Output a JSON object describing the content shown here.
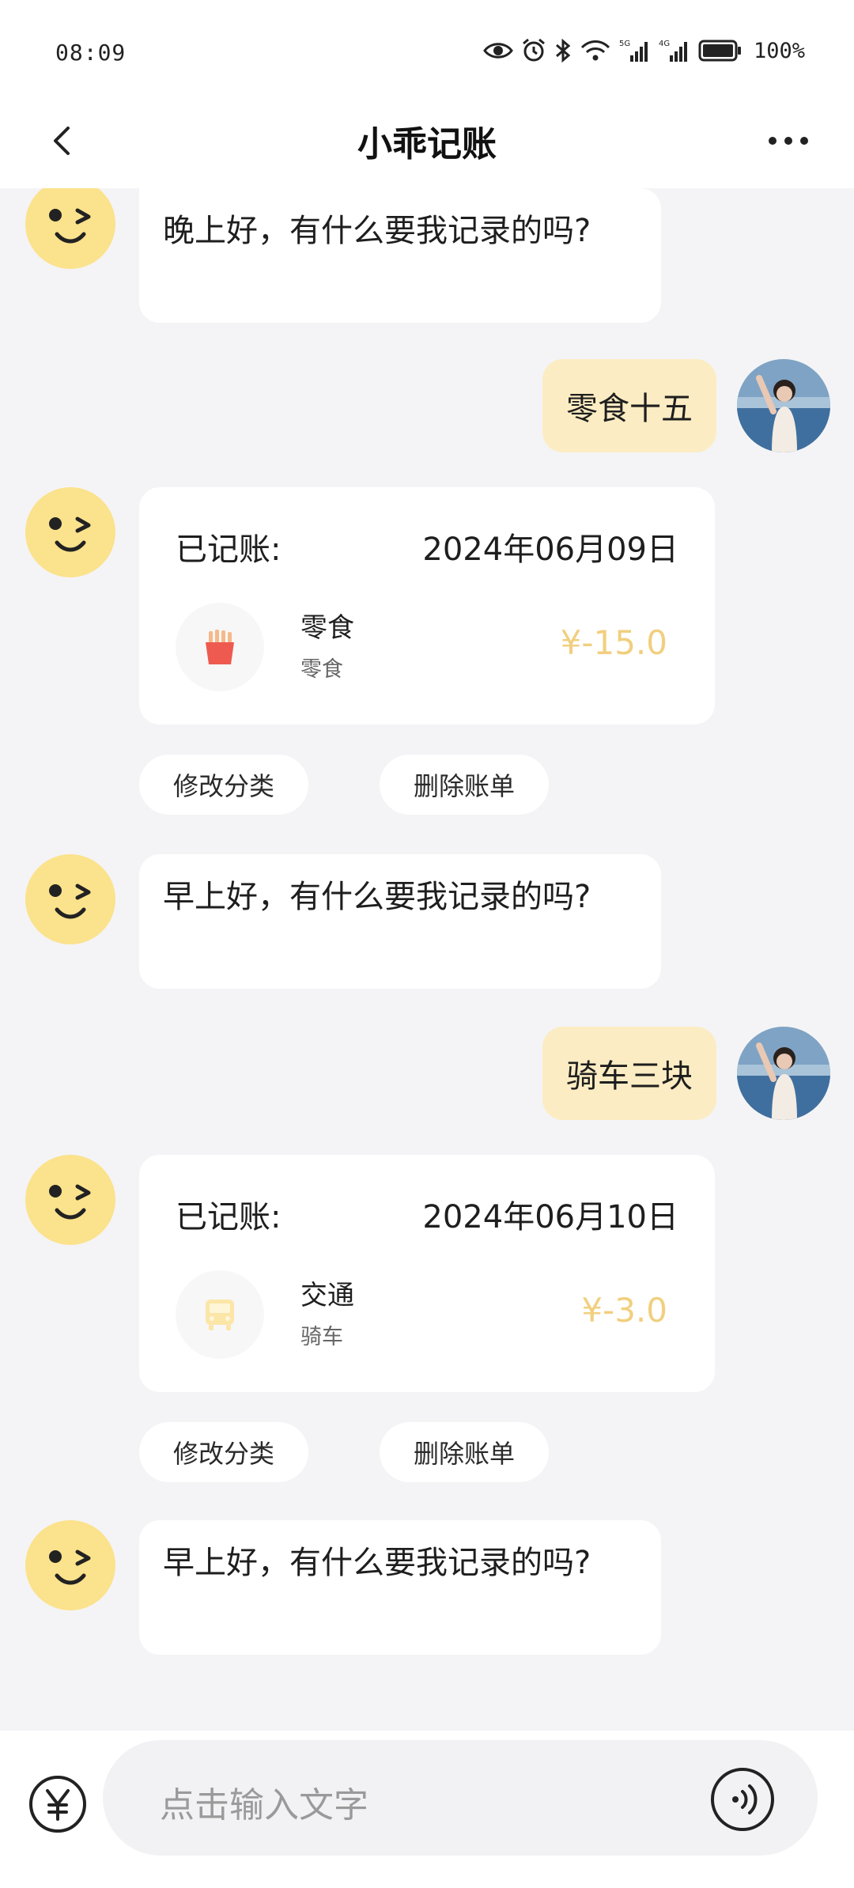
{
  "status_bar": {
    "time": "08:09",
    "battery": "100%",
    "icons": [
      "eye-icon",
      "alarm-icon",
      "bluetooth-icon",
      "wifi-icon",
      "signal-5g-icon",
      "signal-4g-icon",
      "battery-icon"
    ]
  },
  "header": {
    "title": "小乖记账",
    "back_icon": "chevron-left-icon",
    "more_icon": "more-horizontal-icon"
  },
  "messages": [
    {
      "from": "bot",
      "text": "晚上好，有什么要我记录的吗?"
    },
    {
      "from": "user",
      "text": "零食十五"
    },
    {
      "from": "bot",
      "type": "record",
      "label": "已记账:",
      "date": "2024年06月09日",
      "category": "零食",
      "note": "零食",
      "amount": "¥-15.0",
      "icon": "fries-icon",
      "actions": [
        "修改分类",
        "删除账单"
      ]
    },
    {
      "from": "bot",
      "text": "早上好，有什么要我记录的吗?"
    },
    {
      "from": "user",
      "text": "骑车三块"
    },
    {
      "from": "bot",
      "type": "record",
      "label": "已记账:",
      "date": "2024年06月10日",
      "category": "交通",
      "note": "骑车",
      "amount": "¥-3.0",
      "icon": "bus-icon",
      "actions": [
        "修改分类",
        "删除账单"
      ]
    },
    {
      "from": "bot",
      "text": "早上好，有什么要我记录的吗?"
    }
  ],
  "input": {
    "placeholder": "点击输入文字",
    "left_icon": "yen-icon",
    "right_icon": "voice-icon"
  },
  "colors": {
    "accent": "#f1cf7e",
    "user_bubble": "#fcecc3",
    "bot_face": "#fbe28c",
    "background": "#f4f4f6"
  }
}
